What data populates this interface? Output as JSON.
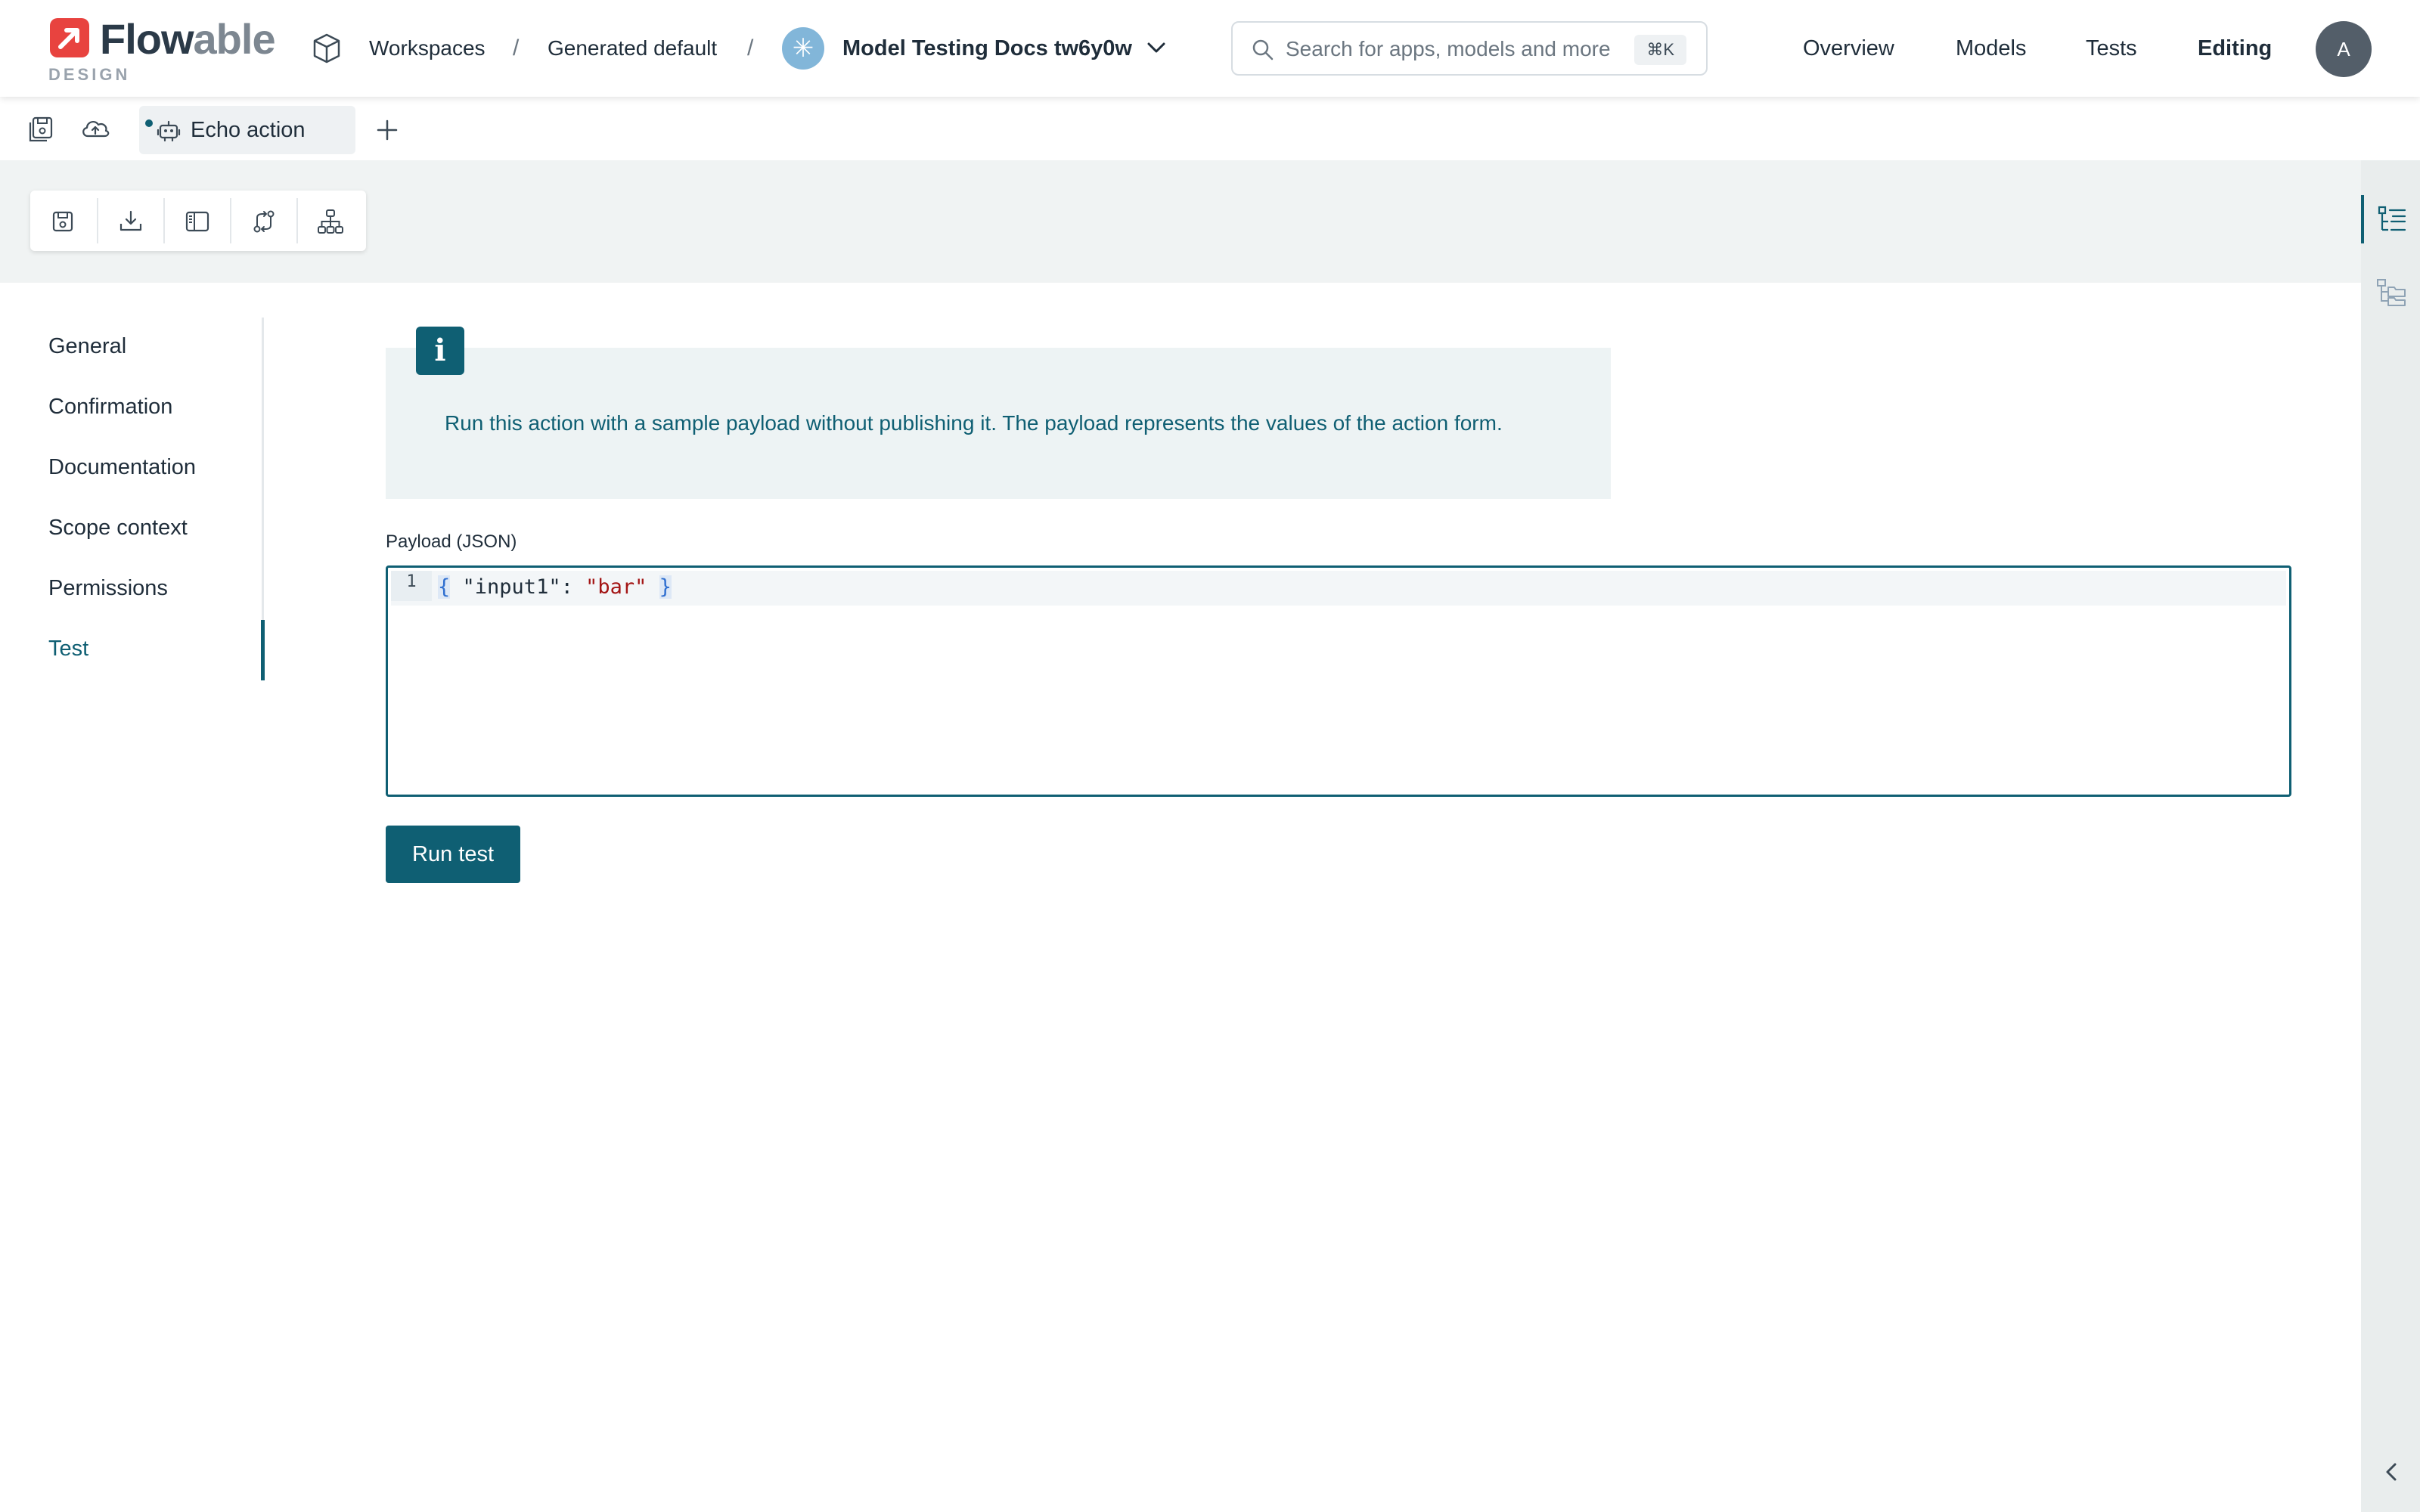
{
  "header": {
    "logo": {
      "wordmark_a": "Flow",
      "wordmark_b": "able",
      "subtitle": "DESIGN"
    },
    "breadcrumb": {
      "workspaces": "Workspaces",
      "separator": "/",
      "workspace": "Generated default",
      "model_badge_glyph": "✳",
      "model": "Model Testing Docs tw6y0w"
    },
    "search": {
      "placeholder": "Search for apps, models and more",
      "value": "",
      "shortcut": "⌘K"
    },
    "nav": {
      "overview": "Overview",
      "models": "Models",
      "tests": "Tests",
      "editing": "Editing"
    },
    "avatar_initial": "A"
  },
  "tabs": {
    "items": [
      {
        "label": "Echo action",
        "unsaved": true,
        "icon": "robot-icon"
      }
    ],
    "add_icon": "plus-icon"
  },
  "toolbar": {
    "tools": [
      "save-icon",
      "download-icon",
      "sidebar-panel-icon",
      "compare-icon",
      "hierarchy-icon"
    ]
  },
  "sidenav": {
    "items": [
      {
        "label": "General",
        "active": false
      },
      {
        "label": "Confirmation",
        "active": false
      },
      {
        "label": "Documentation",
        "active": false
      },
      {
        "label": "Scope context",
        "active": false
      },
      {
        "label": "Permissions",
        "active": false
      },
      {
        "label": "Test",
        "active": true
      }
    ]
  },
  "main": {
    "info_glyph": "i",
    "info_text": "Run this action with a sample payload without publishing it. The payload represents the values of the action form.",
    "payload_label": "Payload (JSON)",
    "editor": {
      "line_number": "1",
      "code": {
        "open": "{",
        "key": "\"input1\"",
        "colon": ": ",
        "value": "\"bar\"",
        "close": "}"
      }
    },
    "run_button": "Run test"
  },
  "colors": {
    "accent": "#0f5f73",
    "brand_red": "#e8433f",
    "info_background": "#edf3f4",
    "band_background": "#f0f3f3"
  }
}
